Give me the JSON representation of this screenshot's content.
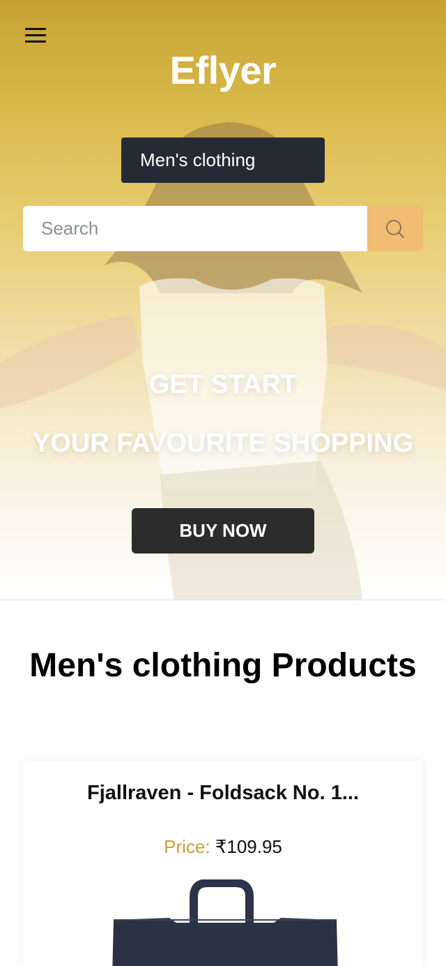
{
  "header": {
    "brand": "Eflyer",
    "category_selected": "Men's clothing"
  },
  "search": {
    "placeholder": "Search",
    "value": ""
  },
  "hero": {
    "tagline_1": "GET START",
    "tagline_2": "YOUR FAVOURITE SHOPPING",
    "cta_label": "BUY NOW"
  },
  "products_section": {
    "title": "Men's clothing Products",
    "items": [
      {
        "name": "Fjallraven - Foldsack No. 1...",
        "price_label": "Price:",
        "price_value": "₹109.95"
      }
    ]
  },
  "colors": {
    "hero_gold": "#c7a233",
    "category_bg": "#262a35",
    "search_button": "#f0bd72",
    "cta_bg": "#2c2c2c",
    "price_label": "#c7a233"
  },
  "icons": {
    "menu": "hamburger-icon",
    "search": "search-icon"
  }
}
